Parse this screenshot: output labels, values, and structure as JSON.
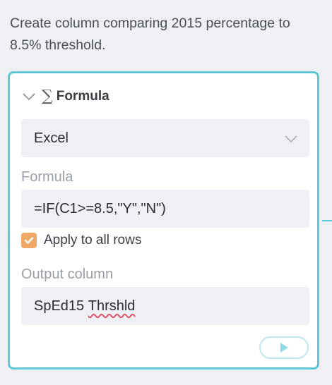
{
  "prompt": "Create column comparing 2015 percentage to 8.5% threshold.",
  "card": {
    "title": "Formula",
    "collapse_icon": "chevron-down-icon",
    "type_icon": "sigma-icon",
    "engine_select": {
      "value": "Excel"
    },
    "formula_label": "Formula",
    "formula_value": "=IF(C1>=8.5,\"Y\",\"N\")",
    "apply_all": {
      "label": "Apply to all rows",
      "checked": true
    },
    "output_label": "Output column",
    "output_value": {
      "part1": "SpEd15",
      "part2": "Thrshld"
    },
    "run_icon": "play-icon"
  },
  "colors": {
    "accent": "#5ec9d9",
    "checkbox": "#f0a866",
    "field_bg": "#eef0f4",
    "spell_underline": "#e0556a"
  }
}
